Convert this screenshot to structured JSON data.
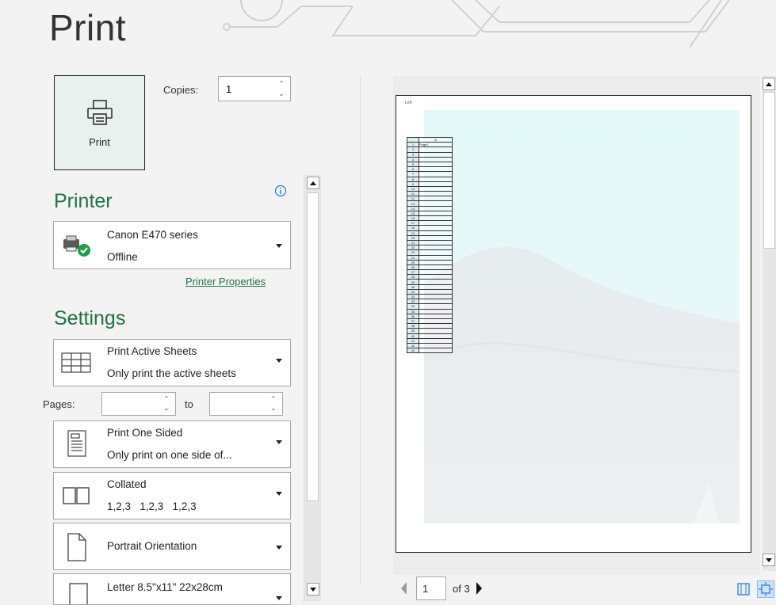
{
  "title": "Print",
  "print_button": {
    "label": "Print",
    "icon": "printer-icon"
  },
  "copies": {
    "label": "Copies:",
    "value": "1"
  },
  "printer": {
    "heading": "Printer",
    "name": "Canon E470 series",
    "status": "Offline",
    "properties_link": "Printer Properties"
  },
  "settings": {
    "heading": "Settings",
    "sheets": {
      "line1": "Print Active Sheets",
      "line2": "Only print the active sheets"
    },
    "pages": {
      "label": "Pages:",
      "from": "",
      "to_label": "to",
      "to": ""
    },
    "sides": {
      "line1": "Print One Sided",
      "line2": "Only print on one side of..."
    },
    "collation": {
      "line1": "Collated",
      "line2": "1,2,3   1,2,3   1,2,3"
    },
    "orientation": {
      "line1": "Portrait Orientation"
    },
    "paper": {
      "line1": "Letter 8.5\"x11\" 22x28cm"
    }
  },
  "preview": {
    "header_text": "Left",
    "column_header": "A",
    "cell_a1": "Page1",
    "row_count": 43,
    "current_page": "1",
    "total_pages": "of 3"
  },
  "colors": {
    "accent": "#217346",
    "print_button_bg": "#e8f1ed"
  }
}
